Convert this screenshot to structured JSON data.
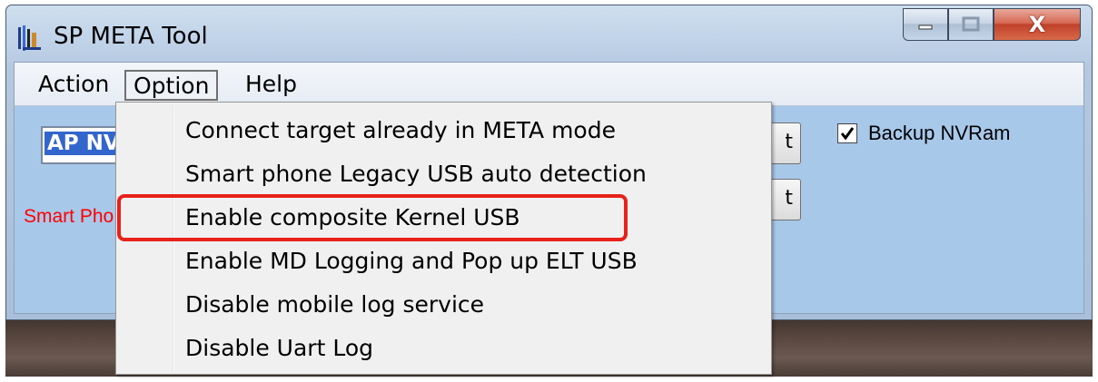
{
  "window": {
    "title": "SP META Tool",
    "icon": "app-icon"
  },
  "caption_buttons": {
    "minimize_icon": "minimize-icon",
    "maximize_icon": "maximize-icon",
    "close_label": "X"
  },
  "menubar": {
    "items": [
      {
        "label": "Action"
      },
      {
        "label": "Option",
        "open": true
      },
      {
        "label": "Help"
      }
    ]
  },
  "content": {
    "ap_field_text": "AP NV",
    "smart_phone_text": "Smart Pho",
    "button1_partial": "t",
    "button2_partial": "t",
    "backup_label": "Backup NVRam",
    "backup_checked": true
  },
  "option_menu": {
    "items": [
      {
        "label": "Connect target already in META mode"
      },
      {
        "label": "Smart phone Legacy USB auto detection"
      },
      {
        "label": "Enable composite Kernel USB",
        "highlighted": true
      },
      {
        "label": "Enable MD Logging and Pop up ELT USB"
      },
      {
        "label": "Disable mobile log service"
      },
      {
        "label": "Disable Uart Log"
      }
    ]
  },
  "colors": {
    "highlight_box": "#e8211a",
    "smart_phone_text": "#ff0000",
    "client_bg": "#a8c8ea"
  }
}
